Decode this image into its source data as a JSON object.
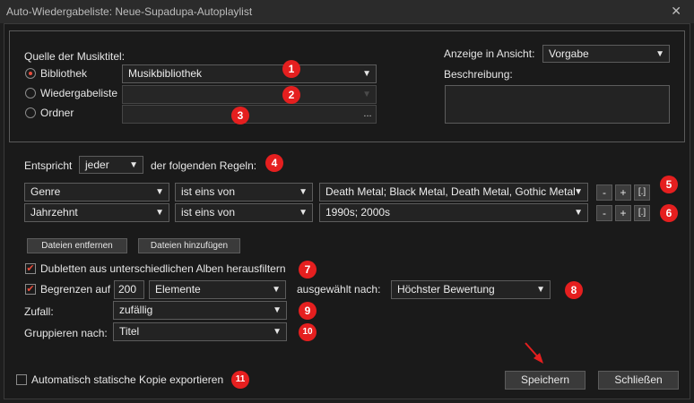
{
  "window": {
    "title": "Auto-Wiedergabeliste: Neue-Supadupa-Autoplaylist",
    "close_glyph": "✕"
  },
  "source": {
    "heading": "Quelle der Musiktitel:",
    "library_label": "Bibliothek",
    "library_value": "Musikbibliothek",
    "playlist_label": "Wiedergabeliste",
    "playlist_value": "",
    "folder_label": "Ordner",
    "folder_value": "",
    "browse_label": "..."
  },
  "view": {
    "label": "Anzeige in Ansicht:",
    "value": "Vorgabe",
    "description_label": "Beschreibung:",
    "description_value": ""
  },
  "match": {
    "prefix": "Entspricht",
    "value": "jeder",
    "suffix": "der folgenden Regeln:"
  },
  "rules": [
    {
      "field": "Genre",
      "operator": "ist eins von",
      "value": "Death Metal; Black Metal, Death Metal, Gothic Metal",
      "minus": "-",
      "plus": "+",
      "group": "[.]"
    },
    {
      "field": "Jahrzehnt",
      "operator": "ist eins von",
      "value": "1990s; 2000s",
      "minus": "-",
      "plus": "+",
      "group": "[.]"
    }
  ],
  "file_buttons": {
    "remove": "Dateien entfernen",
    "add": "Dateien hinzufügen"
  },
  "options": {
    "duplicates_label": "Dubletten aus unterschiedlichen Alben herausfiltern",
    "duplicates_checked": true,
    "limit_label": "Begrenzen auf",
    "limit_checked": true,
    "limit_count": "200",
    "limit_unit": "Elemente",
    "selected_by_label": "ausgewählt nach:",
    "selected_by_value": "Höchster Bewertung",
    "random_label": "Zufall:",
    "random_value": "zufällig",
    "group_label": "Gruppieren nach:",
    "group_value": "Titel",
    "export_label": "Automatisch statische Kopie exportieren",
    "export_checked": false,
    "check_glyph": "✔"
  },
  "actions": {
    "save": "Speichern",
    "close": "Schließen"
  },
  "annotations": {
    "badges": [
      "1",
      "2",
      "3",
      "4",
      "5",
      "6",
      "7",
      "8",
      "9",
      "10",
      "11"
    ],
    "badge_color": "#e51f1f",
    "accent_color": "#e74c3c"
  }
}
